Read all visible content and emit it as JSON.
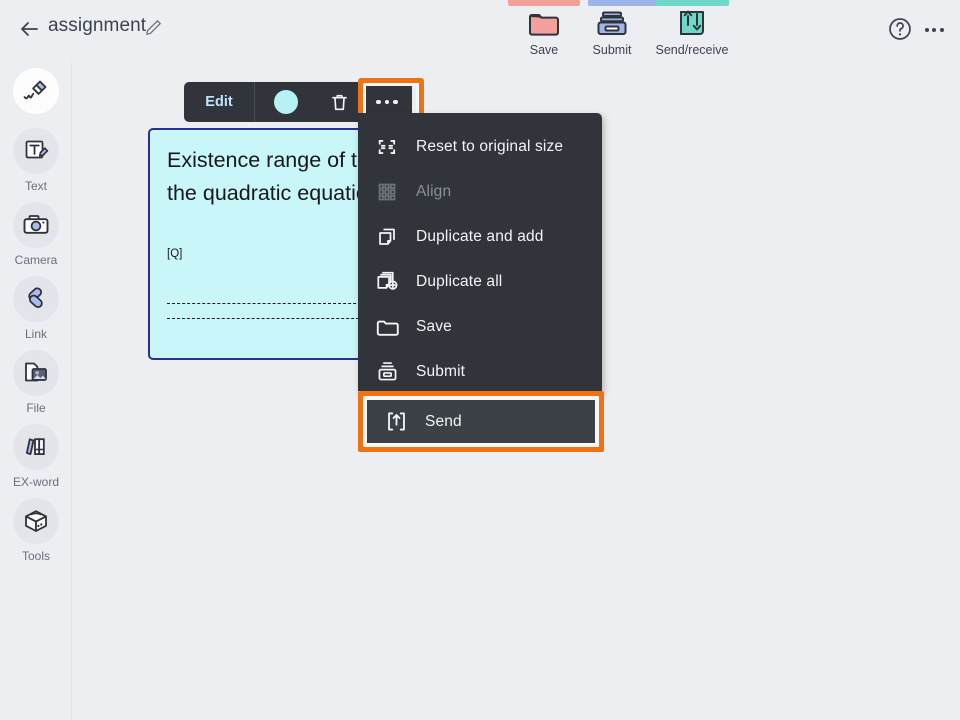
{
  "header": {
    "back_icon": "arrow-left-icon",
    "title": "assignment",
    "edit_title_icon": "pencil-icon",
    "help_icon": "help-circle-icon",
    "overflow_icon": "more-horizontal-icon",
    "tools": [
      {
        "label": "Save",
        "icon": "folder-icon",
        "accent": "#f4a09a"
      },
      {
        "label": "Submit",
        "icon": "tray-icon",
        "accent": "#9fb4ea"
      },
      {
        "label": "Send/receive",
        "icon": "send-receive-icon",
        "accent": "#6fd8c8"
      }
    ]
  },
  "sidebar": {
    "items": [
      {
        "label": "",
        "icon": "pen-icon",
        "selected": true
      },
      {
        "label": "Text",
        "icon": "text-icon",
        "selected": false
      },
      {
        "label": "Camera",
        "icon": "camera-icon",
        "selected": false
      },
      {
        "label": "Link",
        "icon": "link-icon",
        "selected": false
      },
      {
        "label": "File",
        "icon": "file-image-icon",
        "selected": false
      },
      {
        "label": "EX-word",
        "icon": "books-icon",
        "selected": false
      },
      {
        "label": "Tools",
        "icon": "toolbox-icon",
        "selected": false
      }
    ]
  },
  "note": {
    "title": "Existence range of the solution to the quadratic equation",
    "tag": "[Q]",
    "fill_color": "#c9f6f8",
    "border_color": "#2b2f8f"
  },
  "edit_toolbar": {
    "edit_label": "Edit",
    "color_swatch": "#b6f2f5",
    "delete_icon": "trash-icon",
    "more_icon": "more-horizontal-icon",
    "more_highlighted": true
  },
  "menu": {
    "items": [
      {
        "label": "Reset to original size",
        "icon": "shrink-icon",
        "disabled": false,
        "highlighted": false
      },
      {
        "label": "Align",
        "icon": "grid-dots-icon",
        "disabled": true,
        "highlighted": false
      },
      {
        "label": "Duplicate and add",
        "icon": "copy-icon",
        "disabled": false,
        "highlighted": false
      },
      {
        "label": "Duplicate all",
        "icon": "copy-all-icon",
        "disabled": false,
        "highlighted": false
      },
      {
        "label": "Save",
        "icon": "folder-outline-icon",
        "disabled": false,
        "highlighted": false
      },
      {
        "label": "Submit",
        "icon": "tray-outline-icon",
        "disabled": false,
        "highlighted": false
      },
      {
        "label": "Send",
        "icon": "upload-box-icon",
        "disabled": false,
        "highlighted": true
      }
    ]
  },
  "colors": {
    "highlight": "#ef7215",
    "menu_background": "#31353b",
    "page_background": "#edeef2"
  }
}
